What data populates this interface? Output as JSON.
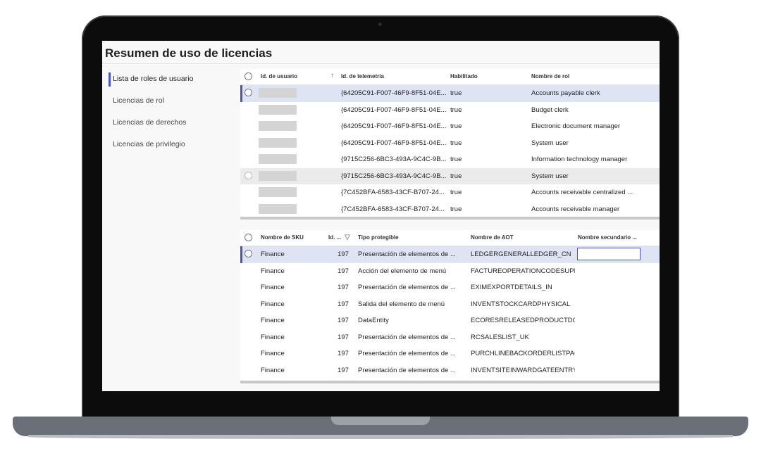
{
  "page": {
    "title": "Resumen de uso de licencias"
  },
  "sidebar": {
    "items": [
      {
        "label": "Lista de roles de usuario"
      },
      {
        "label": "Licencias de rol"
      },
      {
        "label": "Licencias de derechos"
      },
      {
        "label": "Licencias de privilegio"
      }
    ]
  },
  "roles_grid": {
    "headers": {
      "user_id": "Id. de usuario",
      "telemetry_id": "Id. de telemetría",
      "enabled": "Habilitado",
      "role_name": "Nombre de rol"
    },
    "rows": [
      {
        "telemetry_id": "{64205C91-F007-46F9-8F51-04E...",
        "enabled": "true",
        "role_name": "Accounts payable clerk"
      },
      {
        "telemetry_id": "{64205C91-F007-46F9-8F51-04E...",
        "enabled": "true",
        "role_name": "Budget clerk"
      },
      {
        "telemetry_id": "{64205C91-F007-46F9-8F51-04E...",
        "enabled": "true",
        "role_name": "Electronic document manager"
      },
      {
        "telemetry_id": "{64205C91-F007-46F9-8F51-04E...",
        "enabled": "true",
        "role_name": "System user"
      },
      {
        "telemetry_id": "{9715C256-6BC3-493A-9C4C-9B...",
        "enabled": "true",
        "role_name": "Information technology manager"
      },
      {
        "telemetry_id": "{9715C256-6BC3-493A-9C4C-9B...",
        "enabled": "true",
        "role_name": "System user"
      },
      {
        "telemetry_id": "{7C452BFA-6583-43CF-B707-24...",
        "enabled": "true",
        "role_name": "Accounts receivable centralized ..."
      },
      {
        "telemetry_id": "{7C452BFA-6583-43CF-B707-24...",
        "enabled": "true",
        "role_name": "Accounts receivable manager"
      }
    ]
  },
  "sku_grid": {
    "headers": {
      "sku_name": "Nombre de SKU",
      "id": "Id. ...",
      "securable_type": "Tipo protegible",
      "aot_name": "Nombre de AOT",
      "secondary_name": "Nombre secundario ..."
    },
    "rows": [
      {
        "sku": "Finance",
        "id": "197",
        "type": "Presentación de elementos de ...",
        "aot": "LEDGERGENERALLEDGER_CN"
      },
      {
        "sku": "Finance",
        "id": "197",
        "type": "Acción del elemento de menú",
        "aot": "FACTUREOPERATIONCODESUPD..."
      },
      {
        "sku": "Finance",
        "id": "197",
        "type": "Presentación de elementos de ...",
        "aot": "EXIMEXPORTDETAILS_IN"
      },
      {
        "sku": "Finance",
        "id": "197",
        "type": "Salida del elemento de menú",
        "aot": "INVENTSTOCKCARDPHYSICAL"
      },
      {
        "sku": "Finance",
        "id": "197",
        "type": "DataEntity",
        "aot": "ECORESRELEASEDPRODUCTDO..."
      },
      {
        "sku": "Finance",
        "id": "197",
        "type": "Presentación de elementos de ...",
        "aot": "RCSALESLIST_UK"
      },
      {
        "sku": "Finance",
        "id": "197",
        "type": "Presentación de elementos de ...",
        "aot": "PURCHLINEBACKORDERLISTPAG..."
      },
      {
        "sku": "Finance",
        "id": "197",
        "type": "Presentación de elementos de ...",
        "aot": "INVENTSITEINWARDGATEENTRY..."
      }
    ]
  },
  "icons": {
    "sort": "sort-ascending-icon",
    "filter": "filter-icon",
    "radio": "radio-icon"
  },
  "colors": {
    "accent": "#4b53bc",
    "selected_row": "#dfe4f5",
    "bezel": "#0c0c0d"
  }
}
